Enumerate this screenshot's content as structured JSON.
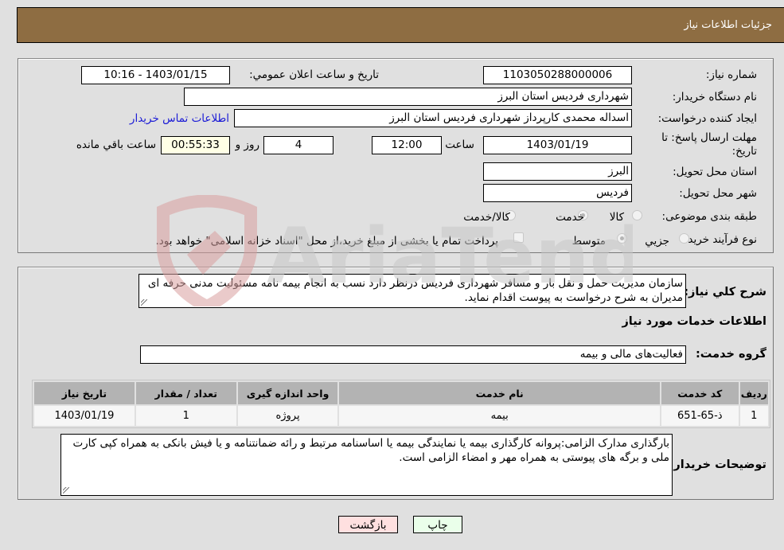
{
  "header": {
    "title": "جزئیات اطلاعات نیاز"
  },
  "form": {
    "need_number_label": "شماره نیاز:",
    "need_number": "1103050288000006",
    "announce_label": "تاریخ و ساعت اعلان عمومي:",
    "announce_value": "1403/01/15 - 10:16",
    "buyer_org_label": "نام دستگاه خریدار:",
    "buyer_org": "شهرداری فردیس استان البرز",
    "creator_label": "ایجاد کننده درخواست:",
    "creator": "اسداله محمدی کارپرداز شهرداری فردیس استان البرز",
    "contact_link": "اطلاعات تماس خریدار",
    "deadline_label": "مهلت ارسال پاسخ: تا تاریخ:",
    "deadline_date": "1403/01/19",
    "time_label": "ساعت",
    "deadline_time": "12:00",
    "days_value": "4",
    "days_label": "روز و",
    "remaining_time": "00:55:33",
    "remaining_label": "ساعت باقي مانده",
    "province_label": "استان محل تحویل:",
    "province": "البرز",
    "city_label": "شهر محل تحویل:",
    "city": "فردیس",
    "category_label": "طبقه بندی موضوعی:",
    "category_options": [
      {
        "label": "کالا",
        "checked": false
      },
      {
        "label": "خدمت",
        "checked": true
      },
      {
        "label": "کالا/خدمت",
        "checked": false
      }
    ],
    "process_label": "نوع فرآیند خرید :",
    "process_options": [
      {
        "label": "جزيي",
        "checked": false
      },
      {
        "label": "متوسط",
        "checked": true
      }
    ],
    "treasury_checkbox_label": "پرداخت تمام یا بخشی از مبلغ خرید،از محل \"اسناد خزانه اسلامی\" خواهد بود.",
    "treasury_checked": false
  },
  "details": {
    "description_label": "شرح كلي نياز:",
    "description": "سازمان مدیریت حمل و نقل بار و مسافر شهرداری فردیس درنظر دارد نسب به انجام بیمه نامه مسئولیت مدنی حرفه ای مدیران به شرح درخواست به پیوست اقدام نماید.",
    "services_heading": "اطلاعات خدمات مورد نیاز",
    "service_group_label": "گروه خدمت:",
    "service_group": "فعالیت‌های مالی و بیمه",
    "table": {
      "headers": [
        "ردیف",
        "کد خدمت",
        "نام خدمت",
        "واحد اندازه گیری",
        "تعداد / مقدار",
        "تاریخ نیاز"
      ],
      "rows": [
        [
          "1",
          "ذ-65-651",
          "بیمه",
          "پروژه",
          "1",
          "1403/01/19"
        ]
      ]
    },
    "buyer_notes_label": "توضیحات خریدار:",
    "buyer_notes": "بارگذاری مدارک الزامی:پروانه کارگذاری بیمه یا نمایندگی بیمه یا اساسنامه مرتبط و رائه ضمانتنامه و یا فیش بانکی به همراه کپی کارت ملی و برگه های پیوستی به همراه مهر و امضاء الزامی است."
  },
  "buttons": {
    "print": "چاپ",
    "back": "بازگشت"
  },
  "watermark": {
    "text": "AriaTender.neT"
  },
  "colors": {
    "header_bg": "#8e6d42",
    "page_bg": "#e0e0e0",
    "link": "#1a1ad6",
    "remaining_bg": "#ffffe6",
    "back_btn_bg": "#ffe0e0",
    "print_btn_bg": "#eaffea",
    "table_header_bg": "#b3b3b3"
  }
}
